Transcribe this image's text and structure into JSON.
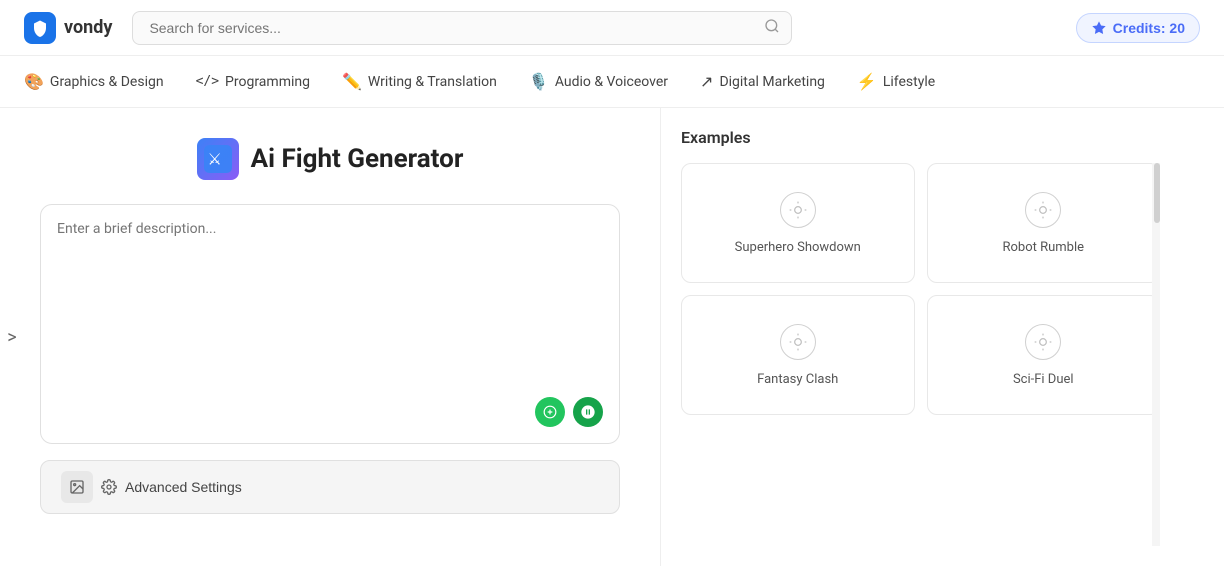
{
  "header": {
    "logo_text": "vondy",
    "search_placeholder": "Search for services...",
    "credits_label": "Credits: 20"
  },
  "nav": {
    "items": [
      {
        "id": "graphics",
        "icon": "🎨",
        "label": "Graphics & Design"
      },
      {
        "id": "programming",
        "icon": "</>",
        "label": "Programming"
      },
      {
        "id": "writing",
        "icon": "✏️",
        "label": "Writing & Translation"
      },
      {
        "id": "audio",
        "icon": "🎙️",
        "label": "Audio & Voiceover"
      },
      {
        "id": "marketing",
        "icon": "📈",
        "label": "Digital Marketing"
      },
      {
        "id": "lifestyle",
        "icon": "⚡",
        "label": "Lifestyle"
      }
    ]
  },
  "page": {
    "title": "Ai Fight Generator",
    "icon_emoji": "⚔️",
    "input_placeholder": "Enter a brief description..."
  },
  "sidebar_arrow": ">",
  "advanced_settings": {
    "label": "Advanced Settings"
  },
  "examples": {
    "section_title": "Examples",
    "cards": [
      {
        "id": "superhero",
        "label": "Superhero Showdown"
      },
      {
        "id": "robot",
        "label": "Robot Rumble"
      },
      {
        "id": "fantasy",
        "label": "Fantasy Clash"
      },
      {
        "id": "scifi",
        "label": "Sci-Fi Duel"
      }
    ]
  }
}
